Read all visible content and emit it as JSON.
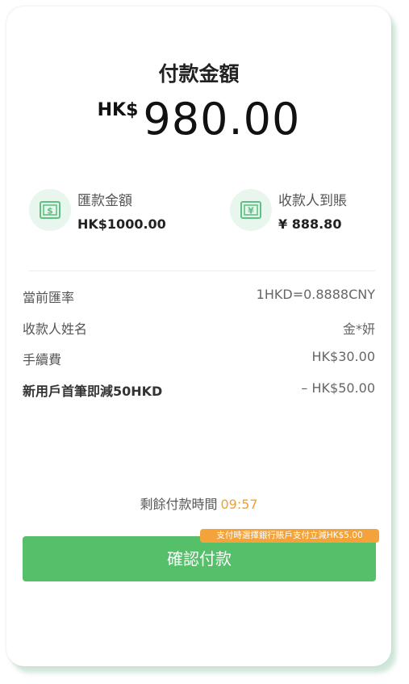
{
  "payment": {
    "title": "付款金額",
    "currency_symbol": "HK$",
    "amount": "980.00"
  },
  "remit": {
    "label": "匯款金額",
    "value": "HK$1000.00",
    "icon": "dollar-bill-icon"
  },
  "receive": {
    "label": "收款人到賬",
    "value": "¥ 888.80",
    "icon": "yuan-bill-icon"
  },
  "details": [
    {
      "key": "當前匯率",
      "value": "1HKD=0.8888CNY"
    },
    {
      "key": "收款人姓名",
      "value": "金*妍"
    },
    {
      "key": "手續費",
      "value": "HK$30.00"
    },
    {
      "key": "新用戶首筆即減50HKD",
      "value": "– HK$50.00"
    }
  ],
  "timer": {
    "label": "剩餘付款時間",
    "value": "09:57"
  },
  "confirm": {
    "label": "確認付款",
    "promo": "支付時選擇銀行賬戶支付立減HK$5.00"
  },
  "colors": {
    "accent_green": "#55bf6a",
    "icon_bg": "#e9f6ee",
    "promo_orange": "#f3a33a",
    "timer_orange": "#f0a030"
  }
}
